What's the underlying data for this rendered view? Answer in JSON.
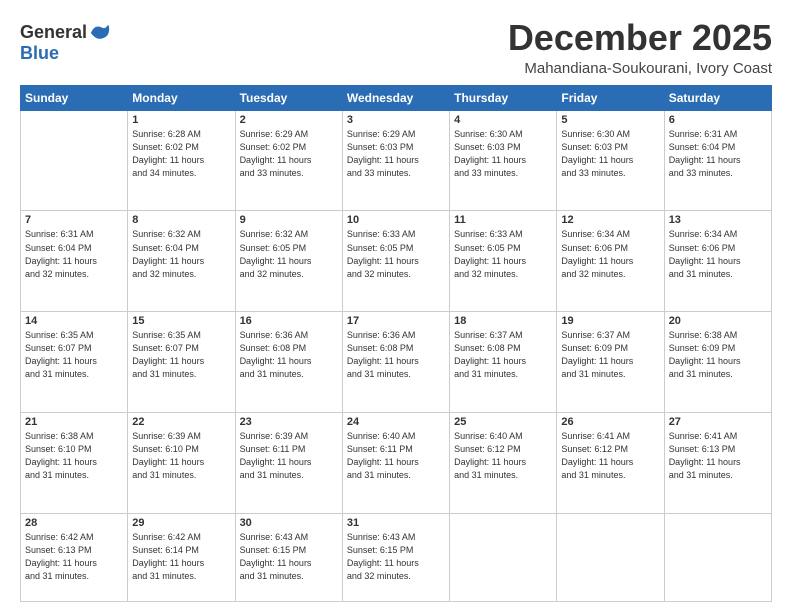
{
  "header": {
    "logo": {
      "general": "General",
      "blue": "Blue"
    },
    "month": "December 2025",
    "location": "Mahandiana-Soukourani, Ivory Coast"
  },
  "weekdays": [
    "Sunday",
    "Monday",
    "Tuesday",
    "Wednesday",
    "Thursday",
    "Friday",
    "Saturday"
  ],
  "weeks": [
    [
      {
        "day": "",
        "info": ""
      },
      {
        "day": "1",
        "info": "Sunrise: 6:28 AM\nSunset: 6:02 PM\nDaylight: 11 hours\nand 34 minutes."
      },
      {
        "day": "2",
        "info": "Sunrise: 6:29 AM\nSunset: 6:02 PM\nDaylight: 11 hours\nand 33 minutes."
      },
      {
        "day": "3",
        "info": "Sunrise: 6:29 AM\nSunset: 6:03 PM\nDaylight: 11 hours\nand 33 minutes."
      },
      {
        "day": "4",
        "info": "Sunrise: 6:30 AM\nSunset: 6:03 PM\nDaylight: 11 hours\nand 33 minutes."
      },
      {
        "day": "5",
        "info": "Sunrise: 6:30 AM\nSunset: 6:03 PM\nDaylight: 11 hours\nand 33 minutes."
      },
      {
        "day": "6",
        "info": "Sunrise: 6:31 AM\nSunset: 6:04 PM\nDaylight: 11 hours\nand 33 minutes."
      }
    ],
    [
      {
        "day": "7",
        "info": "Sunrise: 6:31 AM\nSunset: 6:04 PM\nDaylight: 11 hours\nand 32 minutes."
      },
      {
        "day": "8",
        "info": "Sunrise: 6:32 AM\nSunset: 6:04 PM\nDaylight: 11 hours\nand 32 minutes."
      },
      {
        "day": "9",
        "info": "Sunrise: 6:32 AM\nSunset: 6:05 PM\nDaylight: 11 hours\nand 32 minutes."
      },
      {
        "day": "10",
        "info": "Sunrise: 6:33 AM\nSunset: 6:05 PM\nDaylight: 11 hours\nand 32 minutes."
      },
      {
        "day": "11",
        "info": "Sunrise: 6:33 AM\nSunset: 6:05 PM\nDaylight: 11 hours\nand 32 minutes."
      },
      {
        "day": "12",
        "info": "Sunrise: 6:34 AM\nSunset: 6:06 PM\nDaylight: 11 hours\nand 32 minutes."
      },
      {
        "day": "13",
        "info": "Sunrise: 6:34 AM\nSunset: 6:06 PM\nDaylight: 11 hours\nand 31 minutes."
      }
    ],
    [
      {
        "day": "14",
        "info": "Sunrise: 6:35 AM\nSunset: 6:07 PM\nDaylight: 11 hours\nand 31 minutes."
      },
      {
        "day": "15",
        "info": "Sunrise: 6:35 AM\nSunset: 6:07 PM\nDaylight: 11 hours\nand 31 minutes."
      },
      {
        "day": "16",
        "info": "Sunrise: 6:36 AM\nSunset: 6:08 PM\nDaylight: 11 hours\nand 31 minutes."
      },
      {
        "day": "17",
        "info": "Sunrise: 6:36 AM\nSunset: 6:08 PM\nDaylight: 11 hours\nand 31 minutes."
      },
      {
        "day": "18",
        "info": "Sunrise: 6:37 AM\nSunset: 6:08 PM\nDaylight: 11 hours\nand 31 minutes."
      },
      {
        "day": "19",
        "info": "Sunrise: 6:37 AM\nSunset: 6:09 PM\nDaylight: 11 hours\nand 31 minutes."
      },
      {
        "day": "20",
        "info": "Sunrise: 6:38 AM\nSunset: 6:09 PM\nDaylight: 11 hours\nand 31 minutes."
      }
    ],
    [
      {
        "day": "21",
        "info": "Sunrise: 6:38 AM\nSunset: 6:10 PM\nDaylight: 11 hours\nand 31 minutes."
      },
      {
        "day": "22",
        "info": "Sunrise: 6:39 AM\nSunset: 6:10 PM\nDaylight: 11 hours\nand 31 minutes."
      },
      {
        "day": "23",
        "info": "Sunrise: 6:39 AM\nSunset: 6:11 PM\nDaylight: 11 hours\nand 31 minutes."
      },
      {
        "day": "24",
        "info": "Sunrise: 6:40 AM\nSunset: 6:11 PM\nDaylight: 11 hours\nand 31 minutes."
      },
      {
        "day": "25",
        "info": "Sunrise: 6:40 AM\nSunset: 6:12 PM\nDaylight: 11 hours\nand 31 minutes."
      },
      {
        "day": "26",
        "info": "Sunrise: 6:41 AM\nSunset: 6:12 PM\nDaylight: 11 hours\nand 31 minutes."
      },
      {
        "day": "27",
        "info": "Sunrise: 6:41 AM\nSunset: 6:13 PM\nDaylight: 11 hours\nand 31 minutes."
      }
    ],
    [
      {
        "day": "28",
        "info": "Sunrise: 6:42 AM\nSunset: 6:13 PM\nDaylight: 11 hours\nand 31 minutes."
      },
      {
        "day": "29",
        "info": "Sunrise: 6:42 AM\nSunset: 6:14 PM\nDaylight: 11 hours\nand 31 minutes."
      },
      {
        "day": "30",
        "info": "Sunrise: 6:43 AM\nSunset: 6:15 PM\nDaylight: 11 hours\nand 31 minutes."
      },
      {
        "day": "31",
        "info": "Sunrise: 6:43 AM\nSunset: 6:15 PM\nDaylight: 11 hours\nand 32 minutes."
      },
      {
        "day": "",
        "info": ""
      },
      {
        "day": "",
        "info": ""
      },
      {
        "day": "",
        "info": ""
      }
    ]
  ]
}
